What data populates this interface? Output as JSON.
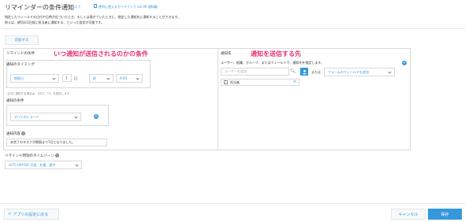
{
  "header": {
    "title": "リマインダーの条件通知",
    "help_link": "ヘルプ",
    "guide_link": "便利に使えるガイドブック vol.09 通知編"
  },
  "description": {
    "line1": "指定したフィールドの日付や日時が近づいたとき、もしくは過ぎていたときに、指定した通知先に通知することができます。",
    "line2": "例えば、締切の3日前に担当者に通知する、といった設定が可能です。"
  },
  "toolbar": {
    "add_label": "追加する"
  },
  "left": {
    "header": "リマインドの条件",
    "annotation": "いつ通知が送信されるのかの条件",
    "timing_label": "通知のタイミング",
    "date_field": "期限日",
    "offset_value": "7",
    "day_unit": "日",
    "direction": "前",
    "time": "9:00",
    "note": "当日に通知する場合は、日付に「0」を指定します。",
    "condition_label": "通知の条件",
    "condition_value": "すべてのレコード",
    "content_label": "通知内容",
    "content_value": "未完了のタスクが期限まで7日となりました。"
  },
  "right": {
    "header": "通知先",
    "annotation": "通知を送信する先",
    "desc": "ユーザー、組織、グループ、またはフィールドで、通知先を指定します。",
    "user_placeholder": "ユーザーを追加",
    "or_text": "または",
    "field_select": "フォームのフィールドを追加",
    "recipient": "担当者"
  },
  "timezone": {
    "label": "リマインド時刻のタイムゾーン",
    "value": "(UTC+09:00) 大阪、札幌、東京"
  },
  "footer": {
    "back_label": "アプリの設定に戻る",
    "cancel_label": "キャンセル",
    "save_label": "保存"
  },
  "icons": {
    "help": "help-icon",
    "guide": "book-icon",
    "add_row": "plus-circle-icon",
    "search": "search-icon",
    "user": "user-icon",
    "remove": "close-icon",
    "back": "chevron-left-icon"
  },
  "colors": {
    "accent": "#3498db",
    "annotation": "#e8336d",
    "border": "#d8d8d8"
  }
}
